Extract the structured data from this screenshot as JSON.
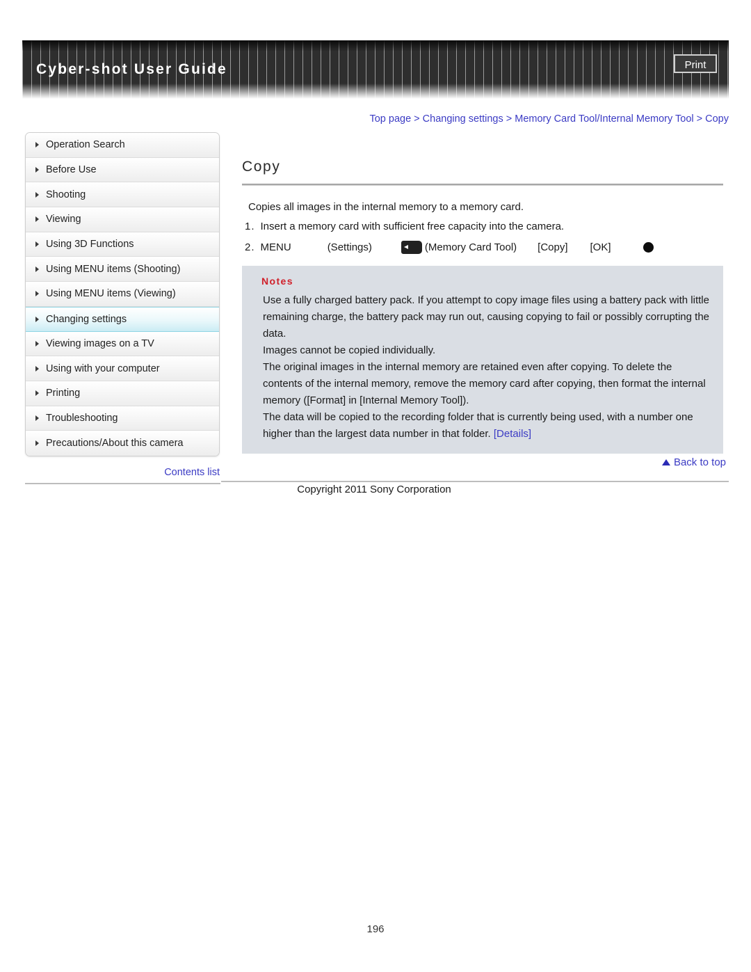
{
  "header": {
    "title": "Cyber-shot User Guide",
    "print_label": "Print",
    "print_icon": "print-icon"
  },
  "breadcrumb": {
    "text": "Top page > Changing settings > Memory Card Tool/Internal Memory Tool > Copy"
  },
  "sidebar": {
    "items": [
      {
        "label": "Operation Search",
        "active": false
      },
      {
        "label": "Before Use",
        "active": false
      },
      {
        "label": "Shooting",
        "active": false
      },
      {
        "label": "Viewing",
        "active": false
      },
      {
        "label": "Using 3D Functions",
        "active": false
      },
      {
        "label": "Using MENU items (Shooting)",
        "active": false
      },
      {
        "label": "Using MENU items (Viewing)",
        "active": false
      },
      {
        "label": "Changing settings",
        "active": true
      },
      {
        "label": "Viewing images on a TV",
        "active": false
      },
      {
        "label": "Using with your computer",
        "active": false
      },
      {
        "label": "Printing",
        "active": false
      },
      {
        "label": "Troubleshooting",
        "active": false
      },
      {
        "label": "Precautions/About this camera",
        "active": false
      }
    ],
    "contents_list_label": "Contents list"
  },
  "main": {
    "title": "Copy",
    "intro": "Copies all images in the internal memory to a memory card.",
    "step1": {
      "number": "1.",
      "text": "Insert a memory card with sufficient free capacity into the camera."
    },
    "step2": {
      "number": "2.",
      "menu": "MENU",
      "settings": "(Settings)",
      "memory_card_tool": "(Memory Card Tool)",
      "copy": "[Copy]",
      "ok": "[OK]",
      "memory_card_icon": "memory-card-icon",
      "confirm_icon": "filled-circle-icon"
    },
    "notes": {
      "heading": "Notes",
      "lines": [
        "Use a fully charged battery pack. If you attempt to copy image files using a battery pack with little remaining charge, the battery pack may run out, causing copying to fail or possibly corrupting the data.",
        "Images cannot be copied individually.",
        "The original images in the internal memory are retained even after copying. To delete the contents of the internal memory, remove the memory card after copying, then format the internal memory ([Format] in [Internal Memory Tool]).",
        "The data will be copied to the recording folder that is currently being used, with a number one higher than the largest data number in that folder."
      ],
      "details_link": "[Details]"
    },
    "back_to_top": "Back to top",
    "back_to_top_icon": "up-triangle-icon"
  },
  "footer": {
    "copyright": "Copyright 2011 Sony Corporation",
    "page_number": "196"
  },
  "colors": {
    "link": "#3b3bc4",
    "notes_heading": "#d0202a",
    "notes_background": "#dadee4",
    "header_background": "#2e2e2e",
    "active_nav": "#caecf4"
  }
}
